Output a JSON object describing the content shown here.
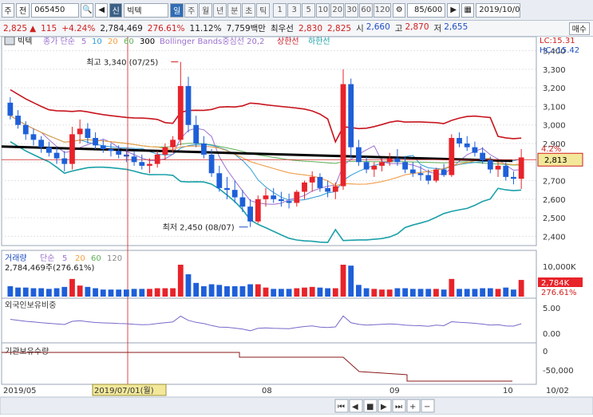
{
  "toolbar": {
    "market": "주",
    "market_full": "전",
    "code": "065450",
    "search_icon": "magnifier-icon",
    "badge_new": "신",
    "stock_name": "빅텍",
    "periods": [
      "일",
      "주",
      "월",
      "년",
      "분",
      "초",
      "틱"
    ],
    "active_period": "일",
    "minute_steps": [
      "1",
      "3",
      "5",
      "10",
      "20",
      "30",
      "60",
      "120"
    ],
    "count": "85/600",
    "date": "2019/10/0"
  },
  "quote": {
    "price": "2,825",
    "change_arrow": "▲",
    "change": "115",
    "change_pct": "+4.24%",
    "volume": "2,784,469",
    "vol_ratio": "276.61%",
    "turnover": "11.12%",
    "amount": "7,759백만",
    "priority": "최우선",
    "best_price": "2,830",
    "best_price2": "2,825",
    "open_label": "시",
    "open": "2,660",
    "high_label": "고",
    "high": "2,870",
    "low_label": "저",
    "low": "2,655",
    "buy_label": "매수"
  },
  "colors": {
    "up": "#e8232a",
    "down": "#1e5fd8",
    "bb_upper": "#c8151e",
    "bb_lower": "#1aa0a8",
    "bb_mid": "#d59ad6",
    "ma300": "#000000",
    "ma5": "#9b6fcf",
    "ma10": "#2c9bd6",
    "ma20": "#f4a13d",
    "ma60": "#5fb157"
  },
  "chart_data": {
    "type": "candlestick",
    "legend": {
      "name": "빅텍",
      "ma_prefix": "종가 단순",
      "ma_periods": [
        "5",
        "10",
        "20",
        "60",
        "300"
      ],
      "bb_label": "Bollinger Bands중심선 20,2",
      "upper_label": "상한선",
      "lower_label": "하한선"
    },
    "lc_label": "LC:15.31",
    "hc_label": "HC:-15.42",
    "price_axis": [
      "3,400",
      "3,300",
      "3,200",
      "3,100",
      "3,000",
      "2,900",
      "2,800",
      "2,700",
      "2,600",
      "2,500",
      "2,400"
    ],
    "price_ylim": [
      2350,
      3450
    ],
    "current_price_label": "2,813",
    "current_price_value": 2813,
    "pct_tag": "4.2%",
    "high_annotation": "최고 3,340 (07/25)",
    "low_annotation": "최저 2,450 (08/07)",
    "high_value": 3340,
    "low_value": 2450,
    "candles": [
      [
        3120,
        3150,
        3030,
        3050
      ],
      [
        3050,
        3080,
        2980,
        3000
      ],
      [
        3000,
        3020,
        2920,
        2950
      ],
      [
        2950,
        2980,
        2890,
        2920
      ],
      [
        2920,
        2940,
        2850,
        2880
      ],
      [
        2880,
        2910,
        2830,
        2850
      ],
      [
        2850,
        2880,
        2790,
        2820
      ],
      [
        2820,
        2860,
        2750,
        2790
      ],
      [
        2790,
        2990,
        2760,
        2950
      ],
      [
        2950,
        3030,
        2900,
        2980
      ],
      [
        2980,
        3010,
        2900,
        2930
      ],
      [
        2930,
        2960,
        2870,
        2890
      ],
      [
        2890,
        2920,
        2850,
        2870
      ],
      [
        2870,
        2900,
        2830,
        2860
      ],
      [
        2860,
        2890,
        2820,
        2840
      ],
      [
        2840,
        2870,
        2800,
        2830
      ],
      [
        2830,
        2860,
        2780,
        2800
      ],
      [
        2800,
        2840,
        2760,
        2780
      ],
      [
        2780,
        2820,
        2740,
        2790
      ],
      [
        2790,
        2860,
        2770,
        2840
      ],
      [
        2840,
        2900,
        2810,
        2880
      ],
      [
        2880,
        2940,
        2850,
        2920
      ],
      [
        2920,
        3340,
        2890,
        3210
      ],
      [
        3210,
        3260,
        2960,
        3000
      ],
      [
        3000,
        3050,
        2880,
        2900
      ],
      [
        2900,
        2940,
        2820,
        2840
      ],
      [
        2840,
        2870,
        2720,
        2740
      ],
      [
        2740,
        2780,
        2640,
        2660
      ],
      [
        2660,
        2720,
        2600,
        2650
      ],
      [
        2650,
        2700,
        2580,
        2610
      ],
      [
        2610,
        2650,
        2530,
        2560
      ],
      [
        2560,
        2600,
        2450,
        2480
      ],
      [
        2480,
        2620,
        2470,
        2600
      ],
      [
        2600,
        2660,
        2560,
        2620
      ],
      [
        2620,
        2660,
        2580,
        2600
      ],
      [
        2600,
        2640,
        2560,
        2590
      ],
      [
        2590,
        2630,
        2550,
        2580
      ],
      [
        2580,
        2650,
        2560,
        2640
      ],
      [
        2640,
        2700,
        2600,
        2690
      ],
      [
        2690,
        2750,
        2640,
        2720
      ],
      [
        2720,
        2740,
        2640,
        2660
      ],
      [
        2660,
        2700,
        2610,
        2640
      ],
      [
        2640,
        2690,
        2600,
        2670
      ],
      [
        2670,
        3300,
        2650,
        3220
      ],
      [
        3220,
        3250,
        2820,
        2880
      ],
      [
        2880,
        2920,
        2780,
        2800
      ],
      [
        2800,
        2830,
        2740,
        2760
      ],
      [
        2760,
        2800,
        2720,
        2780
      ],
      [
        2780,
        2820,
        2750,
        2800
      ],
      [
        2800,
        2850,
        2780,
        2820
      ],
      [
        2820,
        2870,
        2780,
        2800
      ],
      [
        2800,
        2830,
        2740,
        2760
      ],
      [
        2760,
        2800,
        2720,
        2740
      ],
      [
        2740,
        2780,
        2700,
        2730
      ],
      [
        2730,
        2760,
        2680,
        2700
      ],
      [
        2700,
        2770,
        2690,
        2760
      ],
      [
        2760,
        2790,
        2720,
        2730
      ],
      [
        2730,
        2950,
        2720,
        2930
      ],
      [
        2930,
        2960,
        2880,
        2900
      ],
      [
        2900,
        2940,
        2860,
        2880
      ],
      [
        2880,
        2910,
        2830,
        2850
      ],
      [
        2850,
        2880,
        2790,
        2810
      ],
      [
        2810,
        2830,
        2740,
        2760
      ],
      [
        2760,
        2800,
        2720,
        2780
      ],
      [
        2780,
        2800,
        2700,
        2720
      ],
      [
        2720,
        2750,
        2680,
        2710
      ],
      [
        2710,
        2870,
        2655,
        2825
      ]
    ],
    "ma300_level": 2815,
    "volume_pane": {
      "legend": [
        "거래량",
        "단순",
        "5",
        "20",
        "60",
        "120"
      ],
      "value_label": "2,784,469주(276.61%)",
      "axis_label": "10,000K",
      "current_label": "2,784K",
      "pct_label": "276.61%"
    },
    "foreign_pane": {
      "title": "외국인보유비중",
      "axis": [
        "5.00",
        "0.00"
      ]
    },
    "inst_pane": {
      "title": "기관보유수량",
      "axis": [
        "0",
        "-50,000"
      ]
    },
    "x_labels": [
      "2019/05",
      "2019/07/01(월)",
      "08",
      "09",
      "10",
      "10/02"
    ],
    "nav_icons": [
      "first-icon",
      "prev-icon",
      "stop-icon",
      "next-icon",
      "last-icon",
      "zoom-in-icon",
      "zoom-out-icon"
    ]
  }
}
